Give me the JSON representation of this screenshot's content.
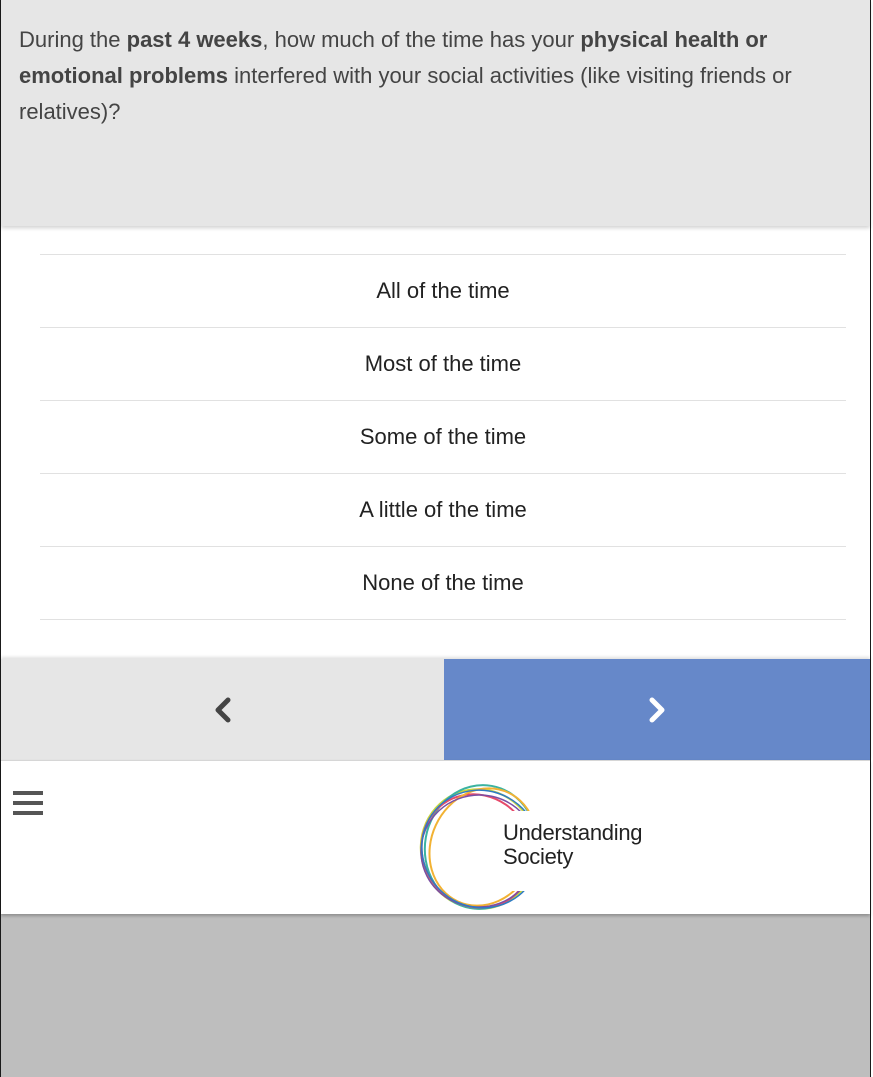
{
  "question": {
    "parts": [
      {
        "text": "During the ",
        "bold": false
      },
      {
        "text": "past 4 weeks",
        "bold": true
      },
      {
        "text": ", how much of the time has your ",
        "bold": false
      },
      {
        "text": "physical health or emotional problems",
        "bold": true
      },
      {
        "text": " interfered with your social activities (like visiting friends or relatives)?",
        "bold": false
      }
    ]
  },
  "answers": [
    {
      "label": "All of the time"
    },
    {
      "label": "Most of the time"
    },
    {
      "label": "Some of the time"
    },
    {
      "label": "A little of the time"
    },
    {
      "label": "None of the time"
    }
  ],
  "nav": {
    "prev_icon": "chevron-left-icon",
    "next_icon": "chevron-right-icon",
    "next_color": "#6688c9",
    "prev_color": "#e6e6e6"
  },
  "footer": {
    "menu_icon": "hamburger-menu-icon",
    "logo": {
      "line1": "Understanding",
      "line2": "Society"
    }
  }
}
